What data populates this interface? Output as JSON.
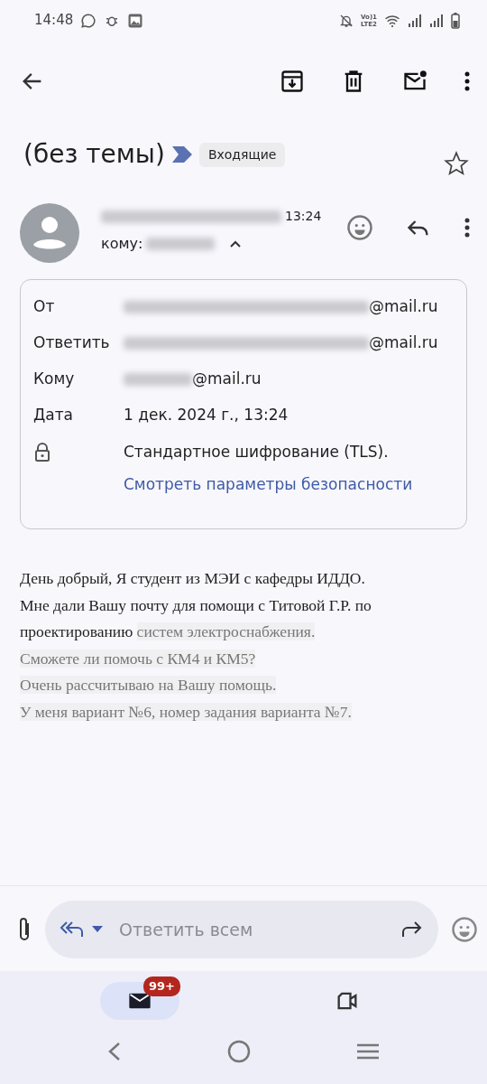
{
  "status_bar": {
    "time": "14:48",
    "network_label": [
      "Vo)1",
      "LTE2"
    ]
  },
  "subject": {
    "title": "(без темы)",
    "label": "Входящие",
    "starred": false
  },
  "message": {
    "time": "13:24",
    "recipient_prefix": "кому:",
    "details_expanded": true,
    "details": [
      {
        "kind": "field",
        "label": "От",
        "value": "@mail.ru",
        "redacted_prefix": true
      },
      {
        "kind": "field",
        "label": "Ответить",
        "value": "@mail.ru",
        "redacted_prefix": true
      },
      {
        "kind": "field",
        "label": "Кому",
        "value": "@mail.ru",
        "redacted_prefix": true
      },
      {
        "kind": "field",
        "label": "Дата",
        "value": "1 дек. 2024 г., 13:24",
        "redacted_prefix": false
      },
      {
        "kind": "security",
        "value": "Стандартное шифрование (TLS).",
        "link": "Смотреть параметры безопасности"
      }
    ],
    "body": [
      {
        "parts": [
          {
            "text": "День добрый, Я студент из МЭИ с кафедры ИДДО.",
            "quoted": false
          }
        ]
      },
      {
        "parts": [
          {
            "text": "Мне дали Вашу почту для помощи с Титовой Г.Р. по проектированию ",
            "quoted": false
          },
          {
            "text": "систем электроснабжения.",
            "quoted": true
          }
        ]
      },
      {
        "parts": [
          {
            "text": "Сможете ли помочь с КМ4 и КМ5?",
            "quoted": true
          }
        ]
      },
      {
        "parts": [
          {
            "text": "Очень рассчитываю на Вашу помощь.",
            "quoted": true
          }
        ]
      },
      {
        "parts": [
          {
            "text": "У меня вариант №6, номер задания варианта №7.",
            "quoted": true
          }
        ]
      }
    ]
  },
  "reply_bar": {
    "placeholder": "Ответить всем"
  },
  "bottom_nav": [
    {
      "kind": "mail",
      "selected": true,
      "badge": "99+"
    },
    {
      "kind": "video",
      "selected": false
    }
  ]
}
